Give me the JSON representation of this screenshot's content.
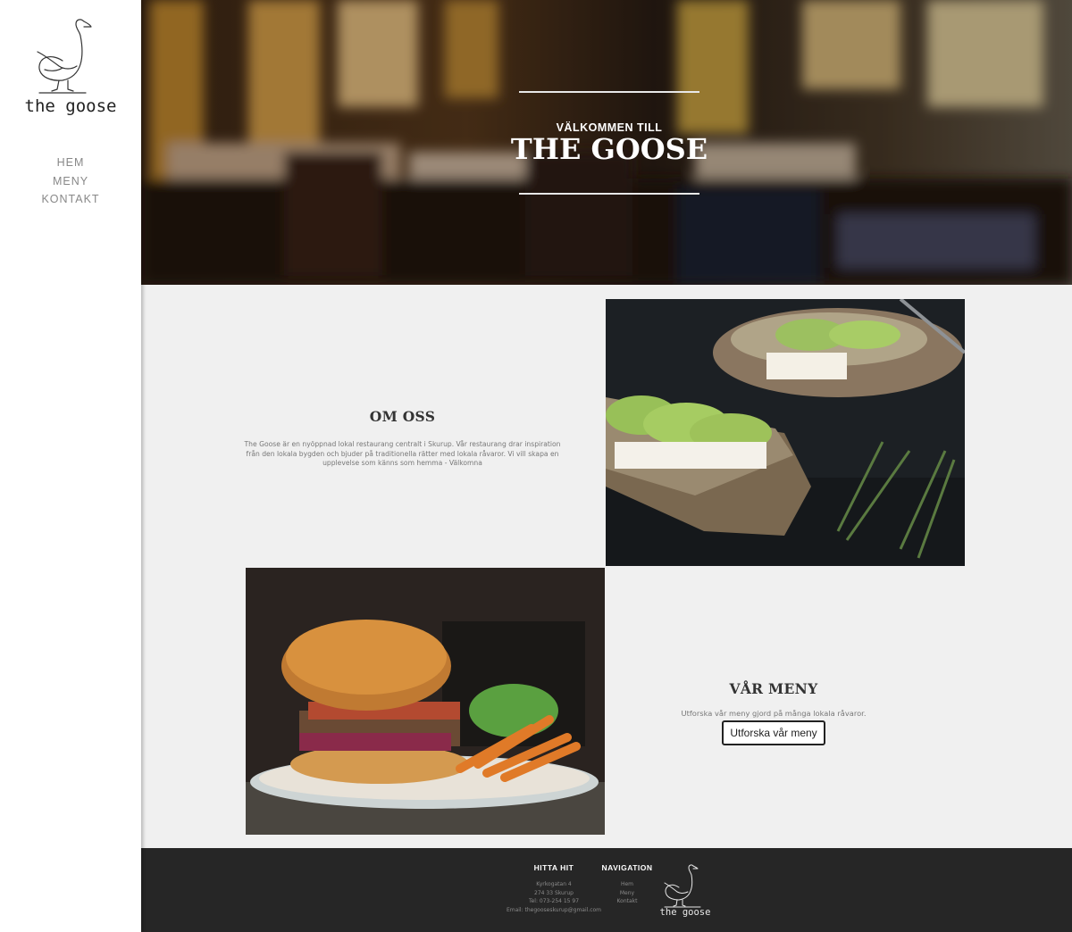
{
  "brand": {
    "name": "the goose"
  },
  "nav": {
    "items": [
      "HEM",
      "MENY",
      "KONTAKT"
    ]
  },
  "hero": {
    "subtitle": "VÄLKOMMEN TILL",
    "title": "THE GOOSE"
  },
  "about": {
    "title": "OM OSS",
    "text": "The Goose är en nyöppnad lokal restaurang centralt i Skurup. Vår restaurang drar inspiration från den lokala bygden och bjuder på traditionella rätter med lokala råvaror. Vi vill skapa en upplevelse som känns som hemma - Välkomna"
  },
  "menu": {
    "title": "VÅR MENY",
    "text": "Utforska vår meny gjord på många lokala råvaror.",
    "button": "Utforska vår meny"
  },
  "footer": {
    "find": {
      "title": "HITTA HIT",
      "lines": [
        "Kyrkogatan 4",
        "274 33 Skurup",
        "Tel: 073-254 15 97",
        "Email: thegooseskurup@gmail.com"
      ]
    },
    "navigation": {
      "title": "NAVIGATION",
      "links": [
        "Hem",
        "Meny",
        "Kontakt"
      ]
    },
    "logo_text": "the goose"
  },
  "colors": {
    "footer_bg": "#262626",
    "page_bg": "#f0f0f0",
    "sidebar_bg": "#ffffff"
  },
  "icons": {
    "logo": "goose-icon"
  }
}
